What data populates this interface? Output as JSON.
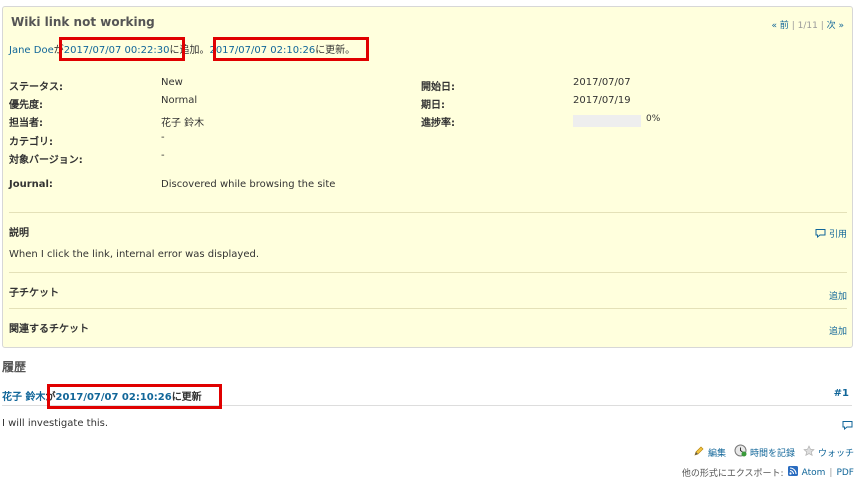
{
  "issue": {
    "subject": "Wiki link not working",
    "pager": {
      "prev": "« 前",
      "position": "1/11",
      "next": "次 »",
      "separator": "|"
    },
    "author": "Jane Doe",
    "created_particle": "が",
    "created_at": "2017/07/07 00:22:30",
    "added_text": "に追加。",
    "updated_at": "2017/07/07 02:10:26",
    "updated_text": "に更新。",
    "attributes": {
      "status": {
        "label": "ステータス:",
        "value": "New"
      },
      "priority": {
        "label": "優先度:",
        "value": "Normal"
      },
      "assignee": {
        "label": "担当者:",
        "value": "花子 鈴木"
      },
      "category": {
        "label": "カテゴリ:",
        "value": "-"
      },
      "target_version": {
        "label": "対象バージョン:",
        "value": "-"
      },
      "start_date": {
        "label": "開始日:",
        "value": "2017/07/07"
      },
      "due_date": {
        "label": "期日:",
        "value": "2017/07/19"
      },
      "done_ratio": {
        "label": "進捗率:",
        "value": "0%",
        "fraction": 0
      },
      "journal_field": {
        "label": "Journal:",
        "value": "Discovered while browsing the site"
      }
    },
    "description": {
      "title": "説明",
      "quote_label": "引用",
      "text": "When I click the link, internal error was displayed."
    },
    "subtasks": {
      "title": "子チケット",
      "add_label": "追加"
    },
    "relations": {
      "title": "関連するチケット",
      "add_label": "追加"
    }
  },
  "history": {
    "title": "履歴",
    "journal": {
      "user": "花子 鈴木",
      "particle": "が",
      "timestamp": "2017/07/07 02:10:26",
      "suffix": "に更新",
      "number": "#1",
      "note": "I will investigate this."
    }
  },
  "actions": {
    "edit": "編集",
    "log_time": "時間を記録",
    "watch": "ウォッチ"
  },
  "export": {
    "prefix": "他の形式にエクスポート:",
    "atom": "Atom",
    "separator": "|",
    "pdf": "PDF"
  },
  "colors": {
    "link": "#116699",
    "issue_background": "#ffffdd",
    "highlight_border": "#e00000"
  }
}
